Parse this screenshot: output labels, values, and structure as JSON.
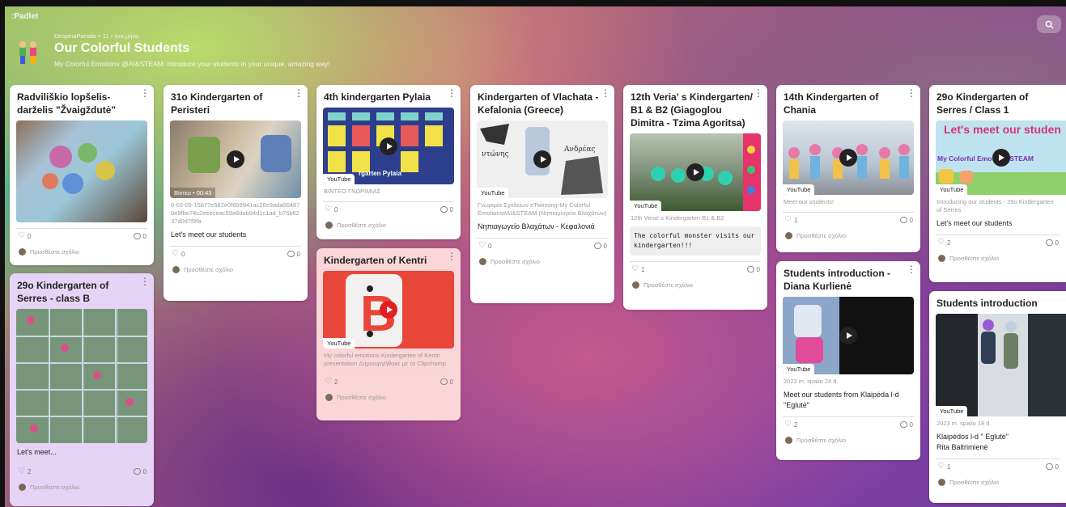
{
  "app": {
    "logo": ":Padlet"
  },
  "header": {
    "meta": "DespinaPartala + 11 • ένα μήνα",
    "title": "Our Colorful Students",
    "description": "My Colorful Emotions @AI&STEAM: Introduce your students in your unique, amazing way!"
  },
  "common": {
    "add_comment": "Προσθέστε σχόλιο",
    "youtube": "YouTube"
  },
  "cards": {
    "c1": {
      "title": "Radviliškio lopšelis-darželis \"Žvaigždutė\"",
      "likes": "0",
      "comments": "0"
    },
    "c2": {
      "title": "29o Kindergarten of Serres - class B",
      "body": "Let's meet...",
      "likes": "2",
      "comments": "0"
    },
    "c3": {
      "title": "31o Kindergarten of Peristeri",
      "badge": "Βίντεο • 00:43",
      "caption": "0-02-05-15b77e582e0f659941ac26e9ada004870e9fbe74c2eeeceac59a6dab94d1c1ad_b76b6237d0d7f9fa",
      "body": "Let's meet our students",
      "likes": "0",
      "comments": "0"
    },
    "c4": {
      "title": "4th kindergarten Pylaia",
      "caption": "ΒΙΝΤΕΟ ΓΝΩΡΙΜΙΑΣ",
      "likes": "0",
      "comments": "0"
    },
    "c5": {
      "title": "Kindergarten of Kentri",
      "caption": "My colorful emotions Kindergarten of Kentri presentation   Δημιουργήθηκε με το Clipchamp",
      "likes": "2",
      "comments": "0"
    },
    "c6": {
      "title": "Kindergarten of Vlachata - Kefalonia (Greece)",
      "caption": "Γνωριμία Σχολείων eTwinning-My Colorful Emotions#AI&STEAM (Νηπιαγωγείο Βλαχάτων)",
      "body": "Νηπιαγωγείο Βλαχάτων - Κεφαλονιά",
      "likes": "0",
      "comments": "0"
    },
    "c7": {
      "title": "12th Veria' s Kindergarten/ B1 & B2 (Giagoglou Dimitra - Tzima Agoritsa)",
      "caption": "12th Veria' s Kindergarten B1 & B2",
      "code": "The colorful monster visits our kindergarten!!!",
      "likes": "1",
      "comments": "0"
    },
    "c8": {
      "title": "14th Kindergarten of Chania",
      "caption": "Meet our students!",
      "likes": "1",
      "comments": "0"
    },
    "c9": {
      "title": "Students introduction - Diana Kurlienė",
      "caption": "2023 m. spalio 24 d.",
      "body": "Meet our students from Klaipėda l-d \"Eglutė\"",
      "likes": "2",
      "comments": "0"
    },
    "c10": {
      "title": "29o Kindergarten of Serres / Class 1",
      "caption": "Introducing our students - 29o Kindergarten of Serres",
      "body": "Let's meet our students",
      "likes": "2",
      "comments": "0"
    },
    "c11": {
      "title": "Students introduction",
      "caption": "2023 m. spalio 18 d.",
      "body": "Klaipėdos l-d \" Eglutė\" Rita Baltrimienė",
      "likes": "1",
      "comments": "0"
    }
  },
  "thumb_text": {
    "c4_overlay": "rgarten Pylaia",
    "c6_word1": "ντώνης",
    "c6_word2": "Ανδρέας",
    "c10_banner": "Let's meet our studen",
    "c10_sub": "My Colorful Emo     #AI&STEAM"
  }
}
